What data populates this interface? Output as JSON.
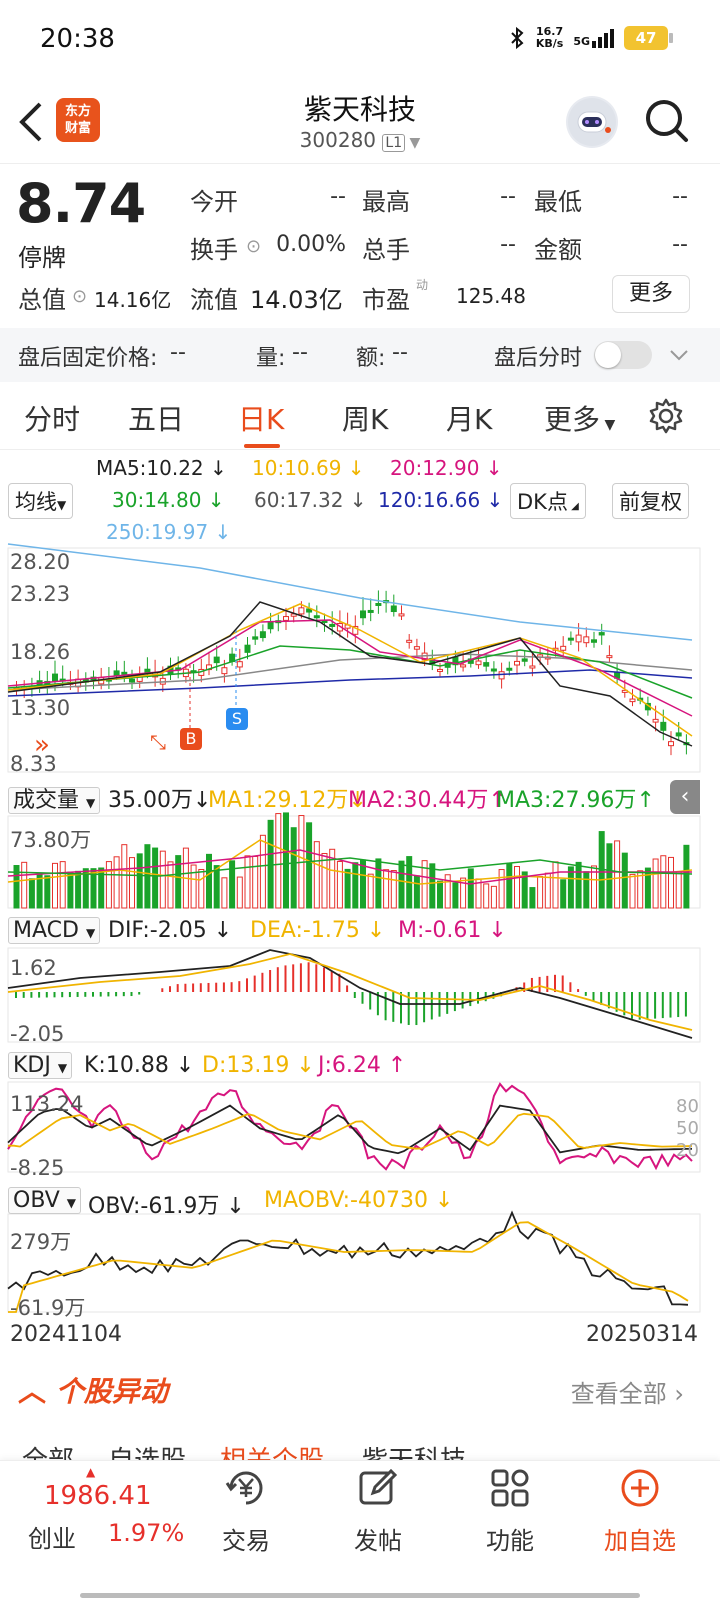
{
  "status_bar": {
    "time": "20:38",
    "net_speed_value": "16.7",
    "net_speed_unit": "KB/s",
    "signal_label": "5G",
    "battery": "47"
  },
  "header": {
    "title": "紫天科技",
    "code": "300280",
    "level": "L1",
    "logo_line1": "东方",
    "logo_line2": "财富"
  },
  "quote": {
    "price": "8.74",
    "status": "停牌",
    "open_label": "今开",
    "open_value": "--",
    "high_label": "最高",
    "high_value": "--",
    "low_label": "最低",
    "low_value": "--",
    "turnover_label": "换手",
    "turnover_value": "0.00%",
    "total_hands_label": "总手",
    "total_hands_value": "--",
    "amount_label": "金额",
    "amount_value": "--",
    "total_cap_label": "总值",
    "total_cap_value": "14.16亿",
    "float_cap_label": "流值",
    "float_cap_value": "14.03亿",
    "pe_label": "市盈",
    "pe_superscript": "动",
    "pe_value": "125.48",
    "more_label": "更多"
  },
  "after_hours": {
    "fixed_price_label": "盘后固定价格:",
    "fixed_price_value": "--",
    "volume_label": "量:",
    "volume_value": "--",
    "amount_label": "额:",
    "amount_value": "--",
    "timeshare_label": "盘后分时"
  },
  "tabs": [
    "分时",
    "五日",
    "日K",
    "周K",
    "月K",
    "更多"
  ],
  "active_tab": "日K",
  "kline": {
    "indicator_selector": "均线",
    "ma5": "MA5:10.22",
    "ma10": "10:10.69",
    "ma20": "20:12.90",
    "ma30": "30:14.80",
    "ma60": "60:17.32",
    "ma120": "120:16.66",
    "ma250": "250:19.97",
    "dk_label": "DK点",
    "adjust_label": "前复权",
    "axis_labels": [
      "28.20",
      "23.23",
      "18.26",
      "13.30",
      "8.33"
    ],
    "buy_marker": "B",
    "sell_marker": "S"
  },
  "volume": {
    "selector": "成交量",
    "value": "35.00万",
    "ma1": "MA1:29.12万",
    "ma2": "MA2:30.44万",
    "ma3": "MA3:27.96万",
    "axis_top": "73.80万"
  },
  "macd": {
    "selector": "MACD",
    "dif": "DIF:-2.05",
    "dea": "DEA:-1.75",
    "m": "M:-0.61",
    "axis_top": "1.62",
    "axis_bottom": "-2.05"
  },
  "kdj": {
    "selector": "KDJ",
    "k": "K:10.88",
    "d": "D:13.19",
    "j": "J:6.24",
    "axis_top": "113.24",
    "axis_bottom": "-8.25",
    "levels": [
      "80",
      "50",
      "20"
    ]
  },
  "obv": {
    "selector": "OBV",
    "obv": "OBV:-61.9万",
    "maobv": "MAOBV:-40730",
    "axis_top": "279万",
    "axis_bottom": "-61.9万"
  },
  "date_range": {
    "start": "20241104",
    "end": "20250314"
  },
  "movement": {
    "title": "个股异动",
    "view_all": "查看全部",
    "subtabs": [
      "全部",
      "自选股",
      "相关个股",
      "紫天科技"
    ]
  },
  "bottom_bar": {
    "index_value": "1986.41",
    "index_name": "创业",
    "index_pct": "1.97%",
    "items": [
      {
        "label": "交易"
      },
      {
        "label": "发帖"
      },
      {
        "label": "功能"
      },
      {
        "label": "加自选"
      }
    ]
  },
  "colors": {
    "accent": "#e94c1c",
    "up": "#e6302b",
    "down": "#1aa32a",
    "ma5": "#222222",
    "ma10": "#f0b400",
    "ma20": "#d6157e",
    "ma30": "#1aa32a",
    "ma60": "#888888",
    "ma120": "#1f2aa8",
    "ma250": "#6fb5e8"
  }
}
